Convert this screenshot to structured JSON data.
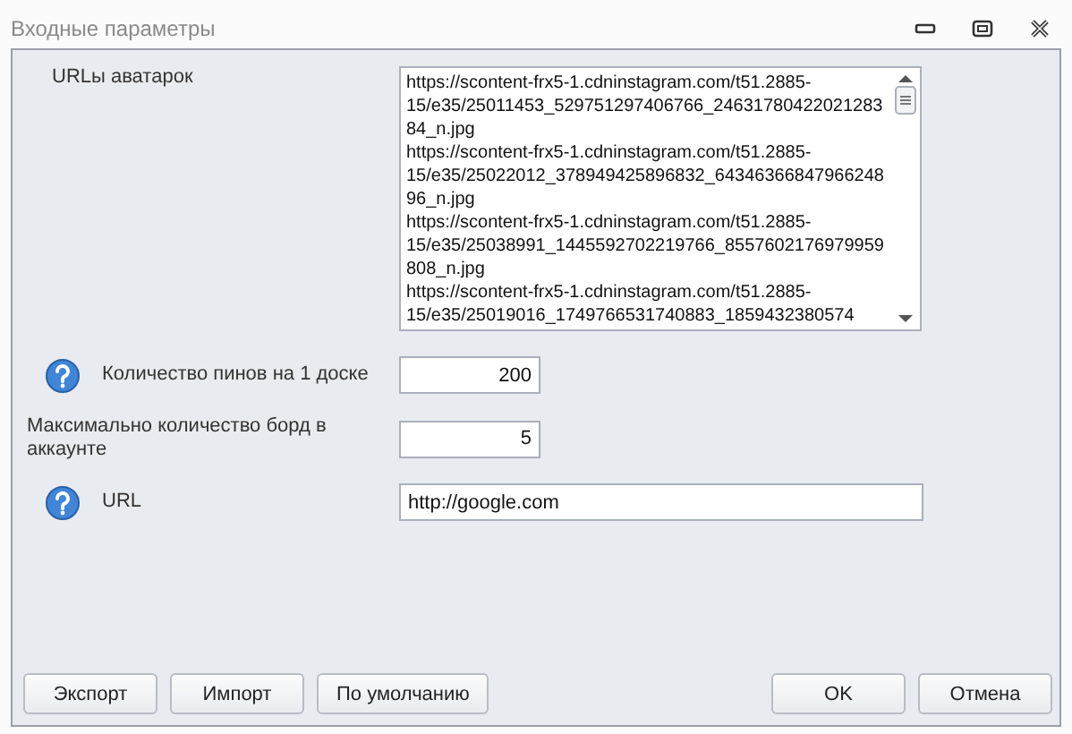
{
  "window": {
    "title": "Входные параметры"
  },
  "avatars": {
    "label": "URLы аватарок",
    "urls": [
      "https://scontent-frx5-1.cdninstagram.com/t51.2885-15/e35/25011453_529751297406766_2463178042202128384_n.jpg",
      "https://scontent-frx5-1.cdninstagram.com/t51.2885-15/e35/25022012_378949425896832_6434636684796624896_n.jpg",
      "https://scontent-frx5-1.cdninstagram.com/t51.2885-15/e35/25038991_1445592702219766_8557602176979959808_n.jpg",
      "https://scontent-frx5-1.cdninstagram.com/t51.2885-15/e35/25019016_1749766531740883_1859432380574"
    ]
  },
  "fields": [
    {
      "label": "Количество пинов на 1 доске",
      "value": "200",
      "help": true,
      "kind": "number"
    },
    {
      "label": "Максимально количество борд в аккаунте",
      "value": "5",
      "help": false,
      "kind": "number"
    },
    {
      "label": "URL",
      "value": "http://google.com",
      "help": true,
      "kind": "text"
    }
  ],
  "buttons_left": [
    "Экспорт",
    "Импорт",
    "По умолчанию"
  ],
  "buttons_right": [
    "OK",
    "Отмена"
  ]
}
